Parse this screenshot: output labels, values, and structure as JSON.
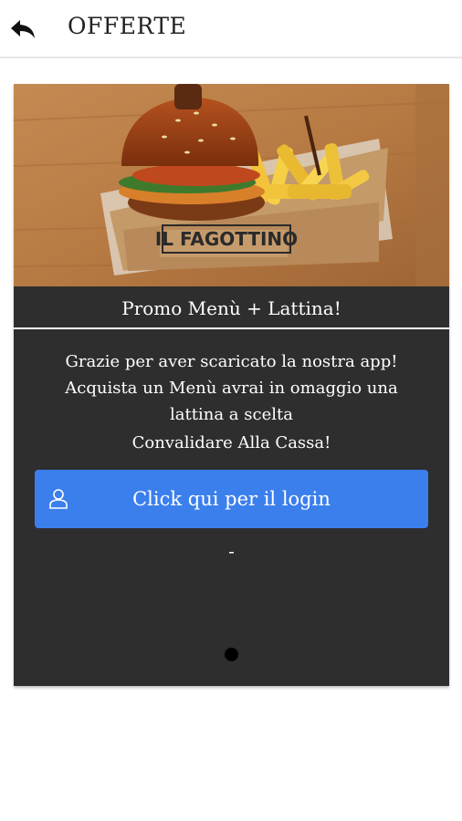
{
  "appbar": {
    "title": "OFFERTE",
    "back_icon": "back-arrow-icon"
  },
  "offer": {
    "image_alt": "burger-and-fries-box-photo",
    "box_brand": "IL FAGOTTINO",
    "title": "Promo Menù + Lattina!",
    "description_lines": [
      "Grazie per aver scaricato la nostra app!",
      "Acquista un Menù avrai in omaggio una",
      "lattina a scelta",
      "Convalidare Alla Cassa!"
    ],
    "login_button": {
      "label": "Click qui per il login",
      "icon": "user-icon"
    },
    "code_placeholder": "-",
    "pagination": {
      "current": 1,
      "total": 1
    }
  },
  "colors": {
    "card_background": "#2e2e2e",
    "button_blue": "#3b7fed",
    "text_white": "#ffffff"
  }
}
